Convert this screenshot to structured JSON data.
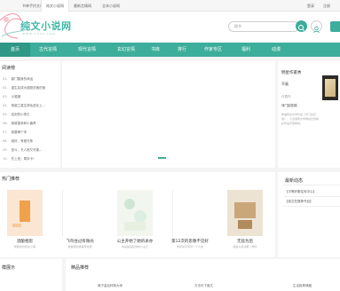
{
  "topbar": {
    "tabs": [
      "",
      "书单手抄文章",
      "纯文小说网",
      "最新言情网",
      "全本小说网"
    ],
    "right_links": [
      "登录",
      "注册"
    ]
  },
  "header": {
    "logo_text": "纯文小说网",
    "logo_sub": "WWW.XXXX.COM",
    "search_placeholder": "搜书"
  },
  "nav": {
    "items": [
      "首页",
      "古代言情",
      "现代言情",
      "玄幻言情",
      "书库",
      "排行",
      "作家专区",
      "福利",
      "动漫"
    ]
  },
  "ranking": {
    "title": "阅读榜",
    "items": [
      {
        "num": "01.",
        "text": "豪门替身的命运"
      },
      {
        "num": "02.",
        "text": "重生后成为超甜总裁的宝"
      },
      {
        "num": "03.",
        "text": "小狐狸"
      },
      {
        "num": "04.",
        "text": "穿越之重生修仙进化上..."
      },
      {
        "num": "05.",
        "text": "捡到的小狼王"
      },
      {
        "num": "06.",
        "text": "我被皇帝和小兽养"
      },
      {
        "num": "07.",
        "text": "我要嫁个沐"
      },
      {
        "num": "08.",
        "text": "她好，有娘无条"
      },
      {
        "num": "09.",
        "text": "宫斗，夫人她又可能..."
      },
      {
        "num": "10.",
        "text": "先上班，周末卡！"
      }
    ]
  },
  "author": {
    "title": "明星作家秀",
    "name": "不画",
    "sub_label": "代表作",
    "book": "浮门如花锦",
    "desc": "偶遇辉煌文学作品《浮门如花锦》，大道湘南文学网站管辖精彩作品问里看的。"
  },
  "recommend": {
    "title": "热门推荐",
    "books": [
      {
        "title": "酒酿相思",
        "desc": "暖暖的奶奶在小镇"
      },
      {
        "title": "飞鸟往过有微光",
        "desc": "故事里的故事有新婚"
      },
      {
        "title": "公主开始了她的表亦",
        "desc": "本是是宫廷城中公主王"
      },
      {
        "title": "第12次的思春不见好",
        "desc": "你就似乎有对一个人的"
      },
      {
        "title": "无盐为后",
        "desc": "她是从来也都一样的"
      }
    ]
  },
  "news": {
    "title": "最新动态",
    "items": [
      "【平等好委住传中心】",
      "【纯文在推荐书目】"
    ]
  },
  "bottom": {
    "left_title": "模展示",
    "mid_title": "精品推荐",
    "items": [
      "离子金后科默大师",
      "方法可下度文",
      "生活极等典藏"
    ]
  }
}
